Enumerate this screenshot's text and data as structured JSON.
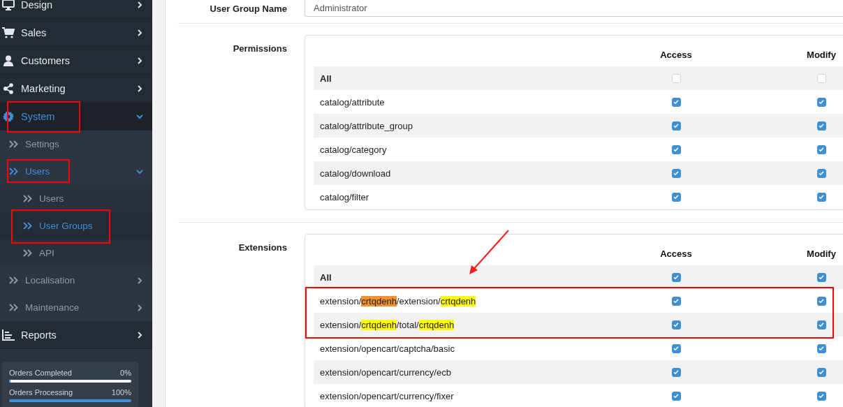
{
  "sidebar": {
    "items": [
      {
        "label": "Design",
        "expanded": false,
        "active": false
      },
      {
        "label": "Sales",
        "expanded": false,
        "active": false
      },
      {
        "label": "Customers",
        "expanded": false,
        "active": false
      },
      {
        "label": "Marketing",
        "expanded": false,
        "active": false
      },
      {
        "label": "System",
        "expanded": true,
        "active": true,
        "children": [
          {
            "label": "Settings",
            "active": false
          },
          {
            "label": "Users",
            "expanded": true,
            "active": true,
            "children": [
              {
                "label": "Users",
                "active": false
              },
              {
                "label": "User Groups",
                "active": true
              },
              {
                "label": "API",
                "active": false
              }
            ]
          },
          {
            "label": "Localisation",
            "expanded": false,
            "active": false
          },
          {
            "label": "Maintenance",
            "expanded": false,
            "active": false
          }
        ]
      },
      {
        "label": "Reports",
        "expanded": false,
        "active": false
      }
    ],
    "stats": [
      {
        "label": "Orders Completed",
        "reading": "0%",
        "level": 0
      },
      {
        "label": "Orders Processing",
        "reading": "100%",
        "level": 1
      }
    ]
  },
  "form": {
    "group_name": {
      "label": "User Group Name",
      "value": "Administrator"
    },
    "sections": [
      {
        "label": "Permissions",
        "columns": [
          "Access",
          "Modify"
        ],
        "rows": [
          {
            "kind": "all",
            "segments": [
              {
                "text": "All",
                "kind": "plain"
              }
            ],
            "access": false,
            "modify": false
          },
          {
            "kind": "route",
            "segments": [
              {
                "text": "catalog/attribute",
                "kind": "plain"
              }
            ],
            "access": true,
            "modify": true
          },
          {
            "kind": "route",
            "segments": [
              {
                "text": "catalog/attribute_group",
                "kind": "plain"
              }
            ],
            "access": true,
            "modify": true
          },
          {
            "kind": "route",
            "segments": [
              {
                "text": "catalog/category",
                "kind": "plain"
              }
            ],
            "access": true,
            "modify": true
          },
          {
            "kind": "route",
            "segments": [
              {
                "text": "catalog/download",
                "kind": "plain"
              }
            ],
            "access": true,
            "modify": true
          },
          {
            "kind": "route",
            "segments": [
              {
                "text": "catalog/filter",
                "kind": "plain"
              }
            ],
            "access": true,
            "modify": true
          }
        ]
      },
      {
        "label": "Extensions",
        "columns": [
          "Access",
          "Modify"
        ],
        "rows": [
          {
            "kind": "all",
            "segments": [
              {
                "text": "All",
                "kind": "plain"
              }
            ],
            "access": true,
            "modify": true
          },
          {
            "kind": "route",
            "segments": [
              {
                "text": "extension/",
                "kind": "plain"
              },
              {
                "text": "crtqdenh",
                "kind": "current_match"
              },
              {
                "text": "/extension/",
                "kind": "plain"
              },
              {
                "text": "crtqdenh",
                "kind": "match"
              }
            ],
            "access": true,
            "modify": true
          },
          {
            "kind": "route",
            "segments": [
              {
                "text": "extension/",
                "kind": "plain"
              },
              {
                "text": "crtqdenh",
                "kind": "match"
              },
              {
                "text": "/total/",
                "kind": "plain"
              },
              {
                "text": "crtqdenh",
                "kind": "match"
              }
            ],
            "access": true,
            "modify": true
          },
          {
            "kind": "route",
            "segments": [
              {
                "text": "extension/opencart/captcha/basic",
                "kind": "plain"
              }
            ],
            "access": true,
            "modify": true
          },
          {
            "kind": "route",
            "segments": [
              {
                "text": "extension/opencart/currency/ecb",
                "kind": "plain"
              }
            ],
            "access": true,
            "modify": true
          },
          {
            "kind": "route",
            "segments": [
              {
                "text": "extension/opencart/currency/fixer",
                "kind": "plain"
              }
            ],
            "access": true,
            "modify": true
          }
        ]
      }
    ]
  }
}
